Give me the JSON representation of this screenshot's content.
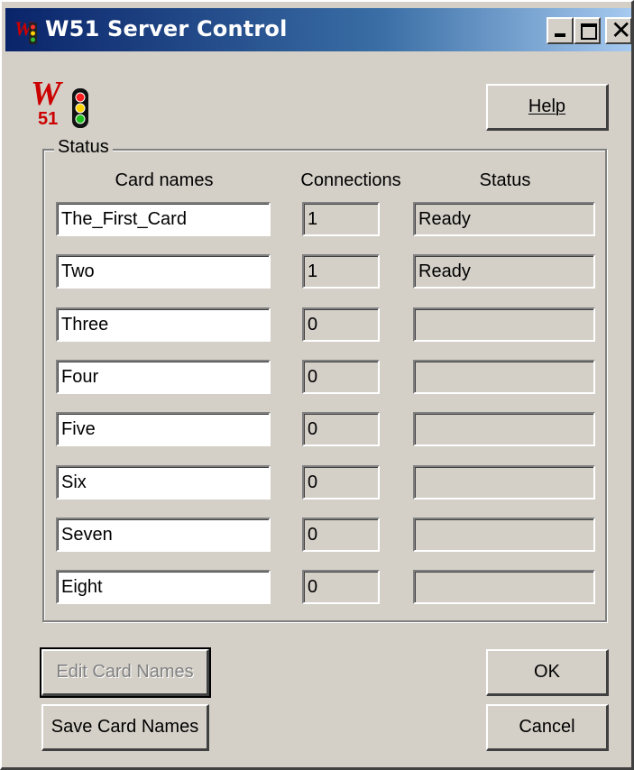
{
  "window": {
    "title": "W51 Server Control"
  },
  "buttons": {
    "help": "Help",
    "edit_card_names": "Edit Card Names",
    "save_card_names": "Save Card Names",
    "ok": "OK",
    "cancel": "Cancel"
  },
  "status_group": {
    "label": "Status",
    "columns": [
      "Card names",
      "Connections",
      "Status"
    ],
    "rows": [
      {
        "name": "The_First_Card",
        "connections": "1",
        "status": "Ready"
      },
      {
        "name": "Two",
        "connections": "1",
        "status": "Ready"
      },
      {
        "name": "Three",
        "connections": "0",
        "status": ""
      },
      {
        "name": "Four",
        "connections": "0",
        "status": ""
      },
      {
        "name": "Five",
        "connections": "0",
        "status": ""
      },
      {
        "name": "Six",
        "connections": "0",
        "status": ""
      },
      {
        "name": "Seven",
        "connections": "0",
        "status": ""
      },
      {
        "name": "Eight",
        "connections": "0",
        "status": ""
      }
    ]
  },
  "logo": {
    "letter": "W",
    "number": "51"
  },
  "colors": {
    "face": "#d4d0c8",
    "title_active": "#0a246a",
    "logo_red": "#cc0000"
  },
  "icons": [
    "app-icon",
    "minimize-icon",
    "maximize-icon",
    "close-icon",
    "traffic-light-icon"
  ]
}
